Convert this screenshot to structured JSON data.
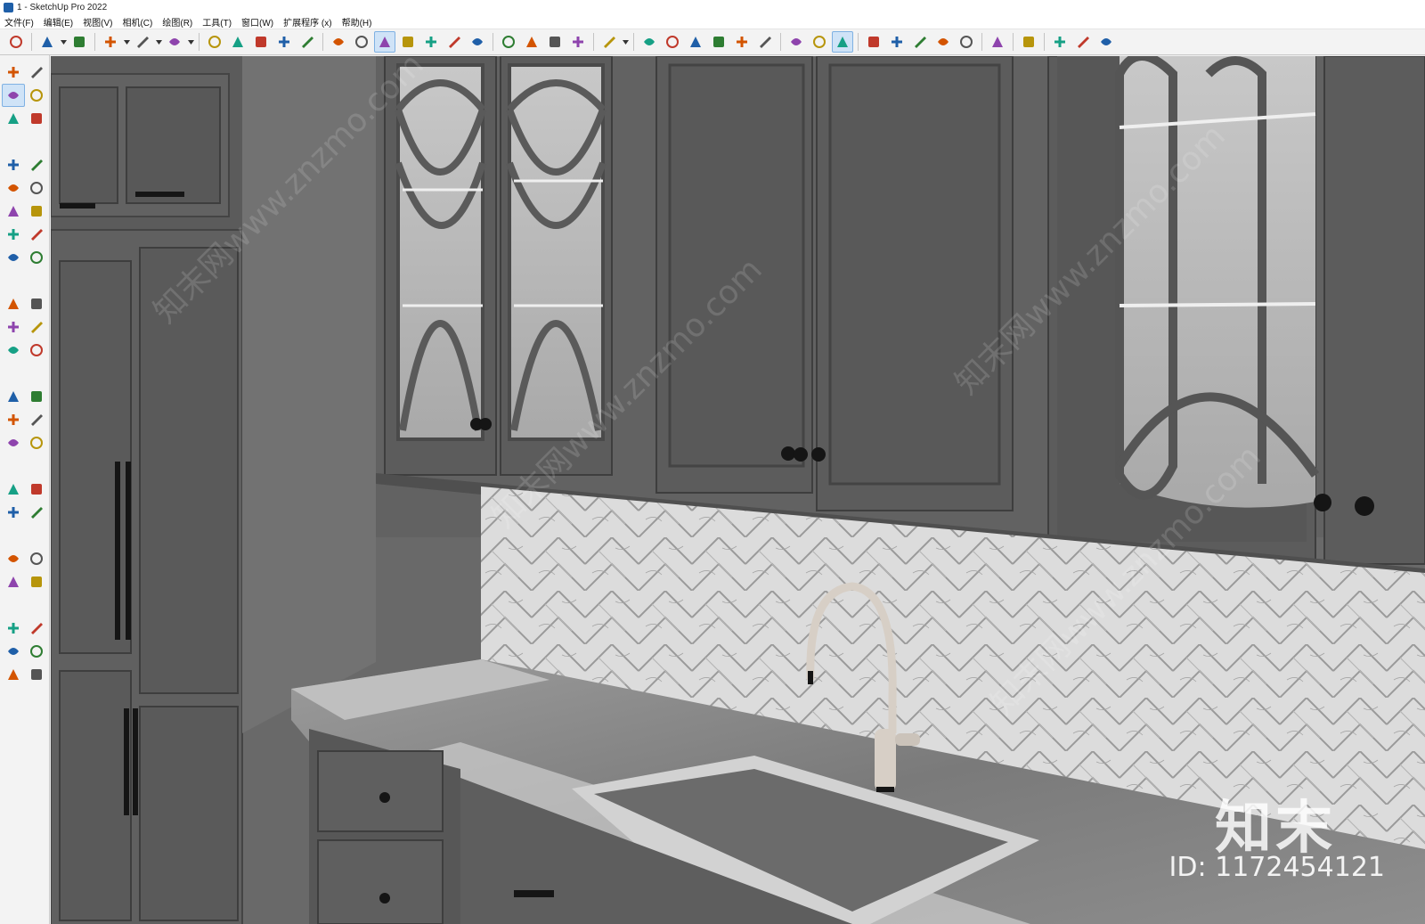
{
  "window": {
    "title": "1 - SketchUp Pro 2022"
  },
  "menu": [
    "文件(F)",
    "编辑(E)",
    "视图(V)",
    "相机(C)",
    "绘图(R)",
    "工具(T)",
    "窗口(W)",
    "扩展程序 (x)",
    "帮助(H)"
  ],
  "toolbar_icons": [
    "search-icon",
    "select-icon",
    "eraser-icon",
    "pencil-icon",
    "arc-icon",
    "rectangle-icon",
    "push-pull-icon",
    "follow-me-icon",
    "move-icon",
    "rotate-icon",
    "scale-icon",
    "tape-measure-icon",
    "text-icon",
    "paint-bucket-icon",
    "orbit-icon",
    "pan-icon",
    "zoom-icon",
    "zoom-extents-icon",
    "section-icon",
    "hide-icon",
    "layers-icon",
    "walk-icon",
    "account-icon",
    "iso-view-icon",
    "front-view-icon",
    "home-view-icon",
    "right-view-icon",
    "top-view-icon",
    "left-view-icon",
    "components-icon",
    "styles-icon",
    "scenes-icon",
    "plus-circle-icon",
    "warehouse-icon",
    "library-icon",
    "checker-icon",
    "cloud-icon",
    "extensions-icon",
    "window-icon",
    "info-icon",
    "cart-icon",
    "profile-icon"
  ],
  "left_tools": [
    "select-icon",
    "orbit-icon",
    "paint-bucket-icon",
    "eraser-icon",
    "section-icon",
    "tag-icon",
    "pencil-icon",
    "freehand-icon",
    "rectangle-icon",
    "rotated-rectangle-icon",
    "circle-icon",
    "polygon-icon",
    "arc-icon",
    "arc-2pt-icon",
    "arc-3pt-icon",
    "pie-icon",
    "move-icon",
    "push-pull-icon",
    "rotate-icon",
    "follow-me-icon",
    "scale-icon",
    "offset-icon",
    "tape-measure-icon",
    "dimension-icon",
    "protractor-icon",
    "text-icon",
    "axes-icon",
    "3d-text-icon",
    "orbit-tool-icon",
    "pan-tool-icon",
    "zoom-tool-icon",
    "zoom-window-icon",
    "zoom-extents-tool-icon",
    "previous-view-icon",
    "position-camera-icon",
    "look-around-icon",
    "walk-tool-icon",
    "section-plane-icon",
    "section-cut-icon",
    "display-section-icon",
    "layers-tool-icon",
    "display-planes-icon"
  ],
  "watermark": {
    "brand": "知末",
    "id_text": "ID: 1172454121",
    "diag_text": "知末网www.znzmo.com"
  },
  "colors": {
    "accent": "#1f5fa8",
    "active_bg": "#cfe3f7",
    "cabinet": "#5e5e5e",
    "cabinet_dark": "#4a4a4a",
    "glass": "#bdbdbd",
    "marble": "#d9d9d9",
    "handle": "#151515"
  }
}
